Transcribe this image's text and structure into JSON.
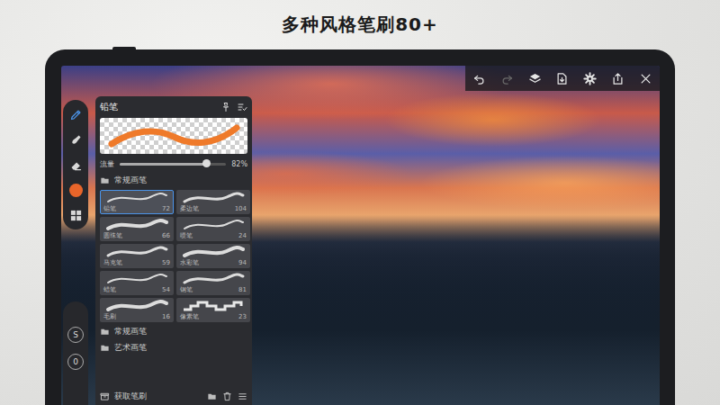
{
  "title": "多种风格笔刷80+",
  "tools": [
    {
      "kind": "tool",
      "selected": true
    },
    {
      "kind": "tool",
      "selected": false
    },
    {
      "kind": "tool",
      "selected": false
    },
    {
      "kind": "swatch",
      "selected": false,
      "color": "#e8652a"
    },
    {
      "kind": "tool",
      "selected": false
    }
  ],
  "side_buttons": [
    "S",
    "0"
  ],
  "top_toolbar": [
    {
      "disabled": false
    },
    {
      "disabled": true
    },
    {
      "disabled": false
    },
    {
      "disabled": false
    },
    {
      "disabled": false
    },
    {
      "disabled": false
    },
    {
      "disabled": false
    }
  ],
  "brush_panel": {
    "title": "铅笔",
    "flow": {
      "label": "流量",
      "level": 0.82,
      "reading": "82%"
    },
    "open_folder": "常规画笔",
    "brushes": [
      {
        "label": "铅笔",
        "count": "72",
        "selected": true,
        "kind": "stroke"
      },
      {
        "label": "柔边笔",
        "count": "104",
        "selected": false,
        "kind": "stroke"
      },
      {
        "label": "圆珠笔",
        "count": "66",
        "selected": false,
        "kind": "stroke"
      },
      {
        "label": "喷笔",
        "count": "24",
        "selected": false,
        "kind": "stroke"
      },
      {
        "label": "马克笔",
        "count": "59",
        "selected": false,
        "kind": "stroke"
      },
      {
        "label": "水彩笔",
        "count": "94",
        "selected": false,
        "kind": "stroke"
      },
      {
        "label": "蜡笔",
        "count": "54",
        "selected": false,
        "kind": "stroke"
      },
      {
        "label": "钢笔",
        "count": "81",
        "selected": false,
        "kind": "stroke"
      },
      {
        "label": "毛刷",
        "count": "16",
        "selected": false,
        "kind": "stroke"
      },
      {
        "label": "像素笔",
        "count": "23",
        "selected": false,
        "kind": "pixel"
      }
    ],
    "folders": [
      "常规画笔",
      "艺术画笔"
    ],
    "get_brushes": "获取笔刷"
  }
}
